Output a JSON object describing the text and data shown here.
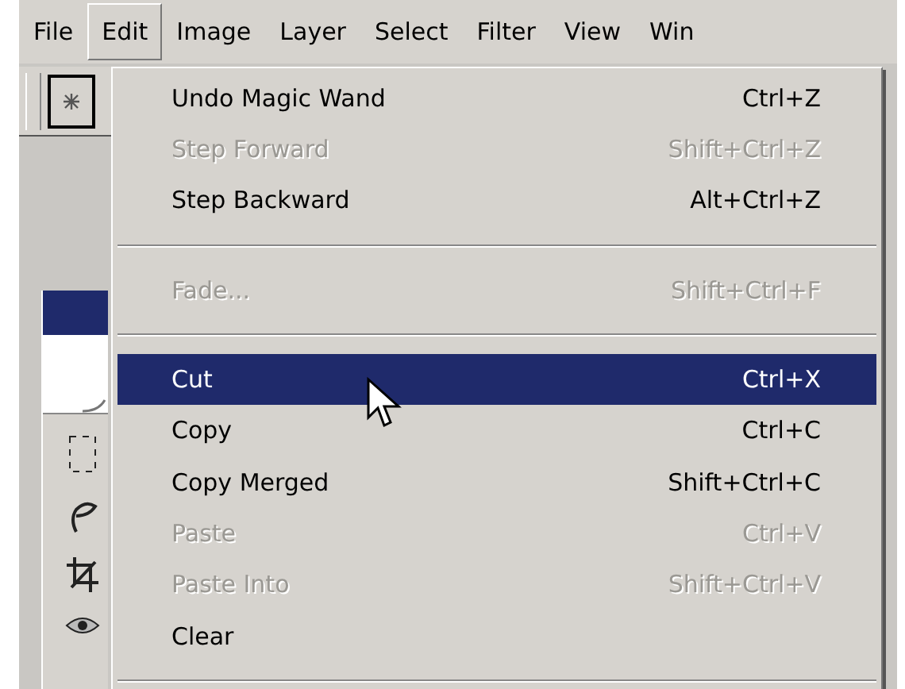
{
  "menubar": [
    {
      "label": "File",
      "selected": false
    },
    {
      "label": "Edit",
      "selected": true
    },
    {
      "label": "Image",
      "selected": false
    },
    {
      "label": "Layer",
      "selected": false
    },
    {
      "label": "Select",
      "selected": false
    },
    {
      "label": "Filter",
      "selected": false
    },
    {
      "label": "View",
      "selected": false
    },
    {
      "label": "Win",
      "selected": false
    }
  ],
  "edit_menu": [
    {
      "kind": "item",
      "label": "Undo Magic Wand",
      "shortcut": "Ctrl+Z",
      "disabled": false,
      "selected": false
    },
    {
      "kind": "item",
      "label": "Step Forward",
      "shortcut": "Shift+Ctrl+Z",
      "disabled": true,
      "selected": false
    },
    {
      "kind": "item",
      "label": "Step Backward",
      "shortcut": "Alt+Ctrl+Z",
      "disabled": false,
      "selected": false
    },
    {
      "kind": "separator"
    },
    {
      "kind": "item",
      "label": "Fade...",
      "shortcut": "Shift+Ctrl+F",
      "disabled": true,
      "selected": false
    },
    {
      "kind": "separator"
    },
    {
      "kind": "item",
      "label": "Cut",
      "shortcut": "Ctrl+X",
      "disabled": false,
      "selected": true
    },
    {
      "kind": "item",
      "label": "Copy",
      "shortcut": "Ctrl+C",
      "disabled": false,
      "selected": false
    },
    {
      "kind": "item",
      "label": "Copy Merged",
      "shortcut": "Shift+Ctrl+C",
      "disabled": false,
      "selected": false
    },
    {
      "kind": "item",
      "label": "Paste",
      "shortcut": "Ctrl+V",
      "disabled": true,
      "selected": false
    },
    {
      "kind": "item",
      "label": "Paste Into",
      "shortcut": "Shift+Ctrl+V",
      "disabled": true,
      "selected": false
    },
    {
      "kind": "item",
      "label": "Clear",
      "disabled": false,
      "selected": false
    },
    {
      "kind": "separator"
    }
  ]
}
